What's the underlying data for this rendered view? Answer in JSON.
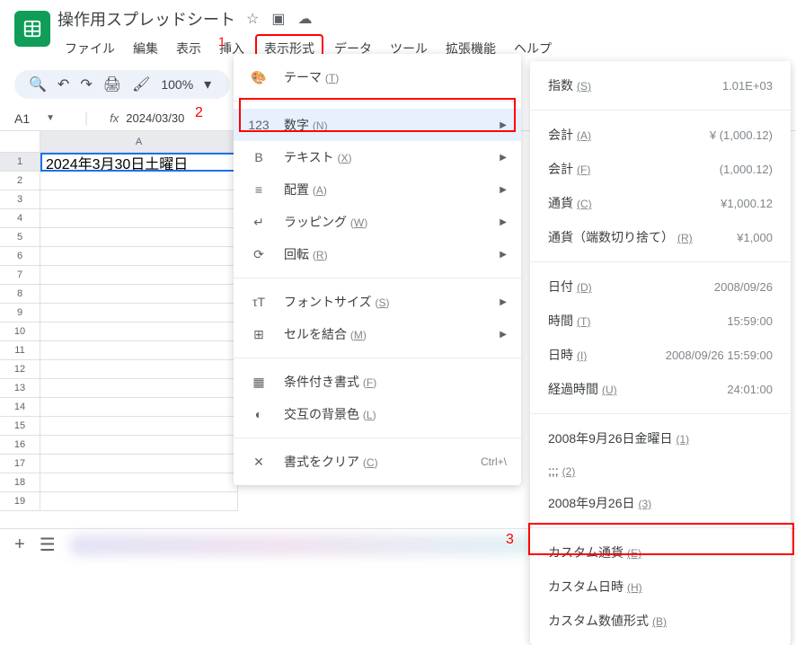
{
  "doc_title": "操作用スプレッドシート",
  "menubar": [
    "ファイル",
    "編集",
    "表示",
    "挿入",
    "表示形式",
    "データ",
    "ツール",
    "拡張機能",
    "ヘルプ"
  ],
  "zoom": "100%",
  "namebox": "A1",
  "formula": "2024/03/30",
  "cell_a1": "2024年3月30日土曜日",
  "col_label": "A",
  "annotations": {
    "a1": "1",
    "a2": "2",
    "a3": "3"
  },
  "menu1": [
    {
      "icon": "🎨",
      "label": "テーマ",
      "key": "T",
      "arrow": false
    },
    {
      "sep": true
    },
    {
      "icon": "123",
      "label": "数字",
      "key": "N",
      "arrow": true,
      "hl": true
    },
    {
      "icon": "B",
      "label": "テキスト",
      "key": "X",
      "arrow": true
    },
    {
      "icon": "≡",
      "label": "配置",
      "key": "A",
      "arrow": true
    },
    {
      "icon": "↵",
      "label": "ラッピング",
      "key": "W",
      "arrow": true
    },
    {
      "icon": "⟳",
      "label": "回転",
      "key": "R",
      "arrow": true
    },
    {
      "sep": true
    },
    {
      "icon": "τT",
      "label": "フォントサイズ",
      "key": "S",
      "arrow": true
    },
    {
      "icon": "⊞",
      "label": "セルを結合",
      "key": "M",
      "arrow": true
    },
    {
      "sep": true
    },
    {
      "icon": "▦",
      "label": "条件付き書式",
      "key": "F",
      "arrow": false
    },
    {
      "icon": "◐",
      "label": "交互の背景色",
      "key": "L",
      "arrow": false
    },
    {
      "sep": true
    },
    {
      "icon": "✕",
      "label": "書式をクリア",
      "key": "C",
      "shortcut": "Ctrl+\\",
      "arrow": false
    }
  ],
  "menu2": [
    {
      "label": "指数",
      "key": "S",
      "val": "1.01E+03"
    },
    {
      "sep": true
    },
    {
      "label": "会計",
      "key": "A",
      "val": "¥ (1,000.12)"
    },
    {
      "label": "会計",
      "key": "F",
      "val": "(1,000.12)"
    },
    {
      "label": "通貨",
      "key": "C",
      "val": "¥1,000.12"
    },
    {
      "label": "通貨（端数切り捨て）",
      "key": "R",
      "val": "¥1,000"
    },
    {
      "sep": true
    },
    {
      "label": "日付",
      "key": "D",
      "val": "2008/09/26"
    },
    {
      "label": "時間",
      "key": "T",
      "val": "15:59:00"
    },
    {
      "label": "日時",
      "key": "I",
      "val": "2008/09/26 15:59:00"
    },
    {
      "label": "経過時間",
      "key": "U",
      "val": "24:01:00"
    },
    {
      "sep": true
    },
    {
      "label": "2008年9月26日金曜日",
      "key": "1",
      "val": ""
    },
    {
      "label": ";;;",
      "key": "2",
      "val": ""
    },
    {
      "label": "2008年9月26日",
      "key": "3",
      "val": ""
    },
    {
      "sep": true
    },
    {
      "label": "カスタム通貨",
      "key": "E",
      "val": ""
    },
    {
      "label": "カスタム日時",
      "key": "H",
      "val": ""
    },
    {
      "label": "カスタム数値形式",
      "key": "B",
      "val": ""
    }
  ]
}
